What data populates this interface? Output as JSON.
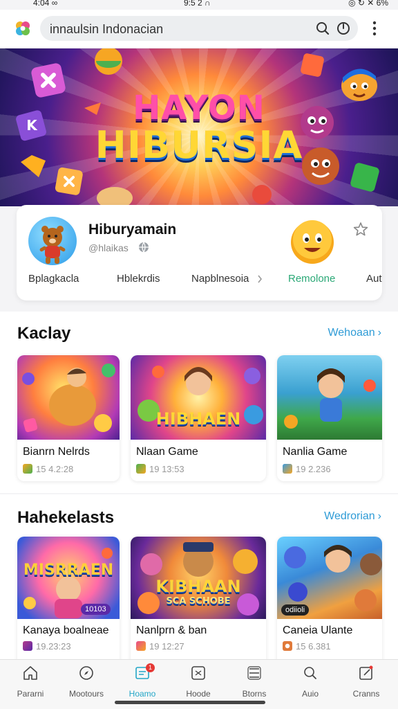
{
  "status_bar": {
    "left": "4:04 ∞",
    "time": "9:5 2 ∩",
    "right": "◎ ↻ ✕ 6%"
  },
  "browser": {
    "url_text": "innaulsin Indonacian"
  },
  "hero": {
    "title_line1": "HAYON",
    "title_line2": "HIBURSIA"
  },
  "profile": {
    "name": "Hiburyamain",
    "handle": "@hlaikas",
    "tabs": [
      "Bplagkacla",
      "Hblekrdis",
      "Napblnesoia",
      "Remolone",
      "Aut"
    ],
    "active_tab": "Remolone"
  },
  "sections": [
    {
      "title": "Kaclay",
      "link": "Wehoaan",
      "games": [
        {
          "name": "Bianrn Nelrds",
          "meta": "15 4.2:28"
        },
        {
          "name": "Nlaan Game",
          "meta": "19 13:53",
          "thumb_text": "HIBHAEN"
        },
        {
          "name": "Nanlia Game",
          "meta": "19 2.236"
        }
      ]
    },
    {
      "title": "Hahekelasts",
      "link": "Wedrorian",
      "games": [
        {
          "name": "Kanaya boalneae",
          "meta": "19.23:23",
          "thumb_text": "MISRRAEN",
          "badge": "10103"
        },
        {
          "name": "Nanlprn & ban",
          "meta": "19 12:27",
          "thumb_text": "KIBHAAN",
          "thumb_sub": "SCA SCHOBE"
        },
        {
          "name": "Caneia Ulante",
          "meta": "15 6.381",
          "badge": "odiioli"
        }
      ]
    }
  ],
  "bottom_nav": [
    {
      "label": "Pararni",
      "icon": "home-icon"
    },
    {
      "label": "Mootours",
      "icon": "compass-icon"
    },
    {
      "label": "Hoamo",
      "icon": "inbox-icon",
      "badge": "1"
    },
    {
      "label": "Hoode",
      "icon": "sparkle-box-icon"
    },
    {
      "label": "Btorns",
      "icon": "list-icon"
    },
    {
      "label": "Auio",
      "icon": "search-icon"
    },
    {
      "label": "Cranns",
      "icon": "edit-icon"
    }
  ],
  "colors": {
    "accent_green": "#2aa876",
    "link_blue": "#2e9bd6",
    "active_nav": "#22a6c7",
    "badge_red": "#e53935"
  }
}
